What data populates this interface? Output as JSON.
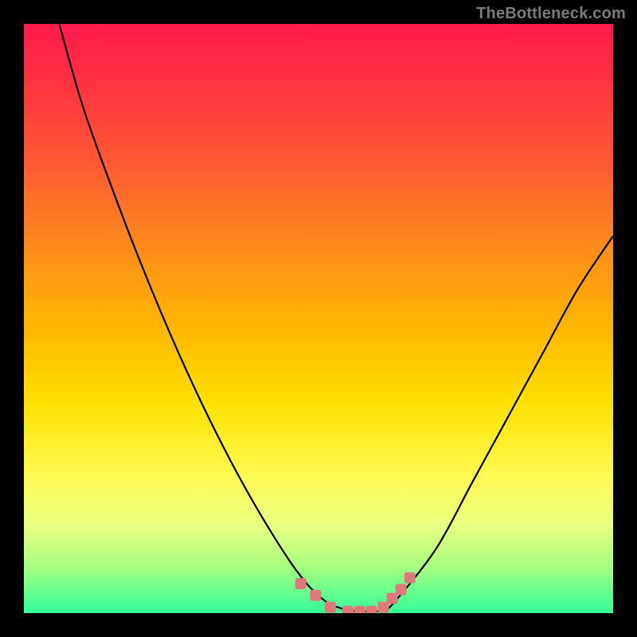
{
  "attribution": "TheBottleneck.com",
  "colors": {
    "frame": "#000000",
    "gradient_top": "#ff1a4d",
    "gradient_bottom": "#33ff99",
    "curve": "#000000",
    "marker": "#e07878"
  },
  "chart_data": {
    "type": "line",
    "title": "",
    "xlabel": "",
    "ylabel": "",
    "xlim": [
      0,
      100
    ],
    "ylim": [
      0,
      100
    ],
    "series": [
      {
        "name": "curve",
        "x": [
          6,
          10,
          15,
          20,
          25,
          30,
          35,
          40,
          45,
          48,
          50,
          52,
          55,
          57,
          59,
          61,
          63,
          70,
          76,
          82,
          88,
          94,
          100
        ],
        "y": [
          100,
          86,
          72,
          59,
          47,
          36,
          26,
          17,
          9,
          5,
          3,
          1.5,
          0.5,
          0.3,
          0.3,
          0.5,
          2,
          11,
          22,
          33,
          44,
          55,
          64
        ]
      }
    ],
    "markers": {
      "name": "highlight-points",
      "x": [
        47,
        49.5,
        52,
        55,
        57,
        59,
        61,
        62.5,
        64,
        65.5
      ],
      "y": [
        5,
        3,
        1,
        0.3,
        0.3,
        0.3,
        1,
        2.5,
        4,
        6
      ]
    }
  }
}
